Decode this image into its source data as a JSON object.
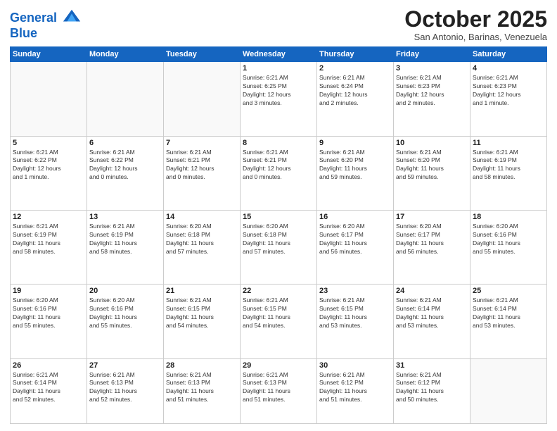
{
  "logo": {
    "line1": "General",
    "line2": "Blue"
  },
  "title": "October 2025",
  "subtitle": "San Antonio, Barinas, Venezuela",
  "days_of_week": [
    "Sunday",
    "Monday",
    "Tuesday",
    "Wednesday",
    "Thursday",
    "Friday",
    "Saturday"
  ],
  "weeks": [
    [
      {
        "day": "",
        "info": ""
      },
      {
        "day": "",
        "info": ""
      },
      {
        "day": "",
        "info": ""
      },
      {
        "day": "1",
        "info": "Sunrise: 6:21 AM\nSunset: 6:25 PM\nDaylight: 12 hours\nand 3 minutes."
      },
      {
        "day": "2",
        "info": "Sunrise: 6:21 AM\nSunset: 6:24 PM\nDaylight: 12 hours\nand 2 minutes."
      },
      {
        "day": "3",
        "info": "Sunrise: 6:21 AM\nSunset: 6:23 PM\nDaylight: 12 hours\nand 2 minutes."
      },
      {
        "day": "4",
        "info": "Sunrise: 6:21 AM\nSunset: 6:23 PM\nDaylight: 12 hours\nand 1 minute."
      }
    ],
    [
      {
        "day": "5",
        "info": "Sunrise: 6:21 AM\nSunset: 6:22 PM\nDaylight: 12 hours\nand 1 minute."
      },
      {
        "day": "6",
        "info": "Sunrise: 6:21 AM\nSunset: 6:22 PM\nDaylight: 12 hours\nand 0 minutes."
      },
      {
        "day": "7",
        "info": "Sunrise: 6:21 AM\nSunset: 6:21 PM\nDaylight: 12 hours\nand 0 minutes."
      },
      {
        "day": "8",
        "info": "Sunrise: 6:21 AM\nSunset: 6:21 PM\nDaylight: 12 hours\nand 0 minutes."
      },
      {
        "day": "9",
        "info": "Sunrise: 6:21 AM\nSunset: 6:20 PM\nDaylight: 11 hours\nand 59 minutes."
      },
      {
        "day": "10",
        "info": "Sunrise: 6:21 AM\nSunset: 6:20 PM\nDaylight: 11 hours\nand 59 minutes."
      },
      {
        "day": "11",
        "info": "Sunrise: 6:21 AM\nSunset: 6:19 PM\nDaylight: 11 hours\nand 58 minutes."
      }
    ],
    [
      {
        "day": "12",
        "info": "Sunrise: 6:21 AM\nSunset: 6:19 PM\nDaylight: 11 hours\nand 58 minutes."
      },
      {
        "day": "13",
        "info": "Sunrise: 6:21 AM\nSunset: 6:19 PM\nDaylight: 11 hours\nand 58 minutes."
      },
      {
        "day": "14",
        "info": "Sunrise: 6:20 AM\nSunset: 6:18 PM\nDaylight: 11 hours\nand 57 minutes."
      },
      {
        "day": "15",
        "info": "Sunrise: 6:20 AM\nSunset: 6:18 PM\nDaylight: 11 hours\nand 57 minutes."
      },
      {
        "day": "16",
        "info": "Sunrise: 6:20 AM\nSunset: 6:17 PM\nDaylight: 11 hours\nand 56 minutes."
      },
      {
        "day": "17",
        "info": "Sunrise: 6:20 AM\nSunset: 6:17 PM\nDaylight: 11 hours\nand 56 minutes."
      },
      {
        "day": "18",
        "info": "Sunrise: 6:20 AM\nSunset: 6:16 PM\nDaylight: 11 hours\nand 55 minutes."
      }
    ],
    [
      {
        "day": "19",
        "info": "Sunrise: 6:20 AM\nSunset: 6:16 PM\nDaylight: 11 hours\nand 55 minutes."
      },
      {
        "day": "20",
        "info": "Sunrise: 6:20 AM\nSunset: 6:16 PM\nDaylight: 11 hours\nand 55 minutes."
      },
      {
        "day": "21",
        "info": "Sunrise: 6:21 AM\nSunset: 6:15 PM\nDaylight: 11 hours\nand 54 minutes."
      },
      {
        "day": "22",
        "info": "Sunrise: 6:21 AM\nSunset: 6:15 PM\nDaylight: 11 hours\nand 54 minutes."
      },
      {
        "day": "23",
        "info": "Sunrise: 6:21 AM\nSunset: 6:15 PM\nDaylight: 11 hours\nand 53 minutes."
      },
      {
        "day": "24",
        "info": "Sunrise: 6:21 AM\nSunset: 6:14 PM\nDaylight: 11 hours\nand 53 minutes."
      },
      {
        "day": "25",
        "info": "Sunrise: 6:21 AM\nSunset: 6:14 PM\nDaylight: 11 hours\nand 53 minutes."
      }
    ],
    [
      {
        "day": "26",
        "info": "Sunrise: 6:21 AM\nSunset: 6:14 PM\nDaylight: 11 hours\nand 52 minutes."
      },
      {
        "day": "27",
        "info": "Sunrise: 6:21 AM\nSunset: 6:13 PM\nDaylight: 11 hours\nand 52 minutes."
      },
      {
        "day": "28",
        "info": "Sunrise: 6:21 AM\nSunset: 6:13 PM\nDaylight: 11 hours\nand 51 minutes."
      },
      {
        "day": "29",
        "info": "Sunrise: 6:21 AM\nSunset: 6:13 PM\nDaylight: 11 hours\nand 51 minutes."
      },
      {
        "day": "30",
        "info": "Sunrise: 6:21 AM\nSunset: 6:12 PM\nDaylight: 11 hours\nand 51 minutes."
      },
      {
        "day": "31",
        "info": "Sunrise: 6:21 AM\nSunset: 6:12 PM\nDaylight: 11 hours\nand 50 minutes."
      },
      {
        "day": "",
        "info": ""
      }
    ]
  ]
}
